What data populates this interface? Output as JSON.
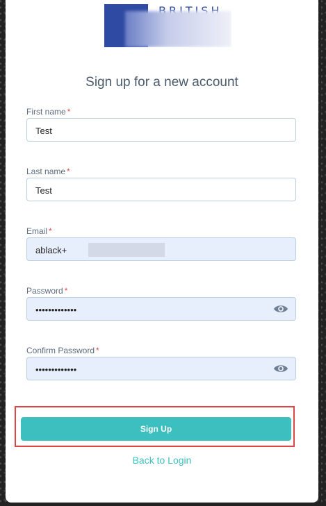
{
  "logo": {
    "word": "BRITISH"
  },
  "page_title": "Sign up for a new account",
  "fields": {
    "first_name": {
      "label": "First name",
      "required_mark": "*",
      "value": "Test"
    },
    "last_name": {
      "label": "Last name",
      "required_mark": "*",
      "value": "Test"
    },
    "email": {
      "label": "Email",
      "required_mark": "*",
      "value": "ablack+"
    },
    "password": {
      "label": "Password",
      "required_mark": "*",
      "value": "•••••••••••••"
    },
    "confirm_password": {
      "label": "Confirm Password",
      "required_mark": "*",
      "value": "•••••••••••••"
    }
  },
  "signup_button": {
    "label": "Sign Up"
  },
  "back_link": {
    "label": "Back to Login"
  },
  "colors": {
    "accent": "#3dbfbf",
    "required": "#e04b4b",
    "highlight_frame": "#e04545"
  }
}
